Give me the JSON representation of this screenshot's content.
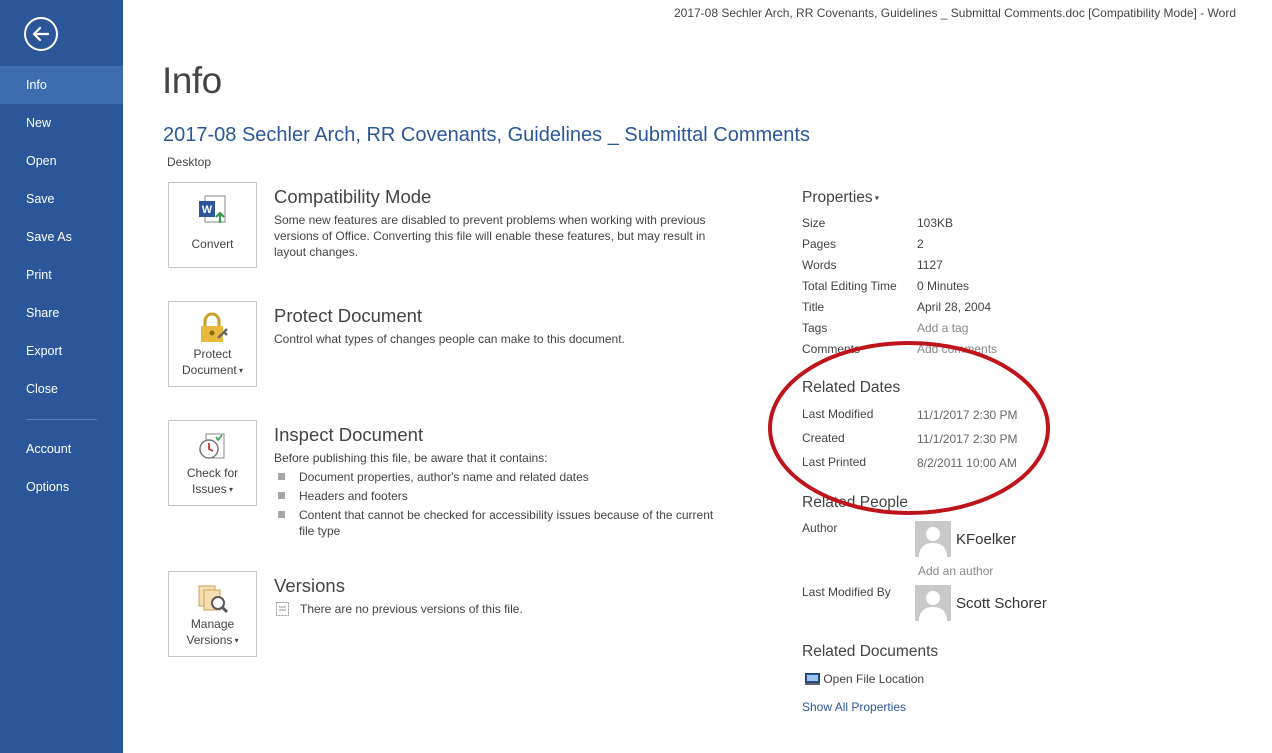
{
  "window": {
    "title": "2017-08 Sechler Arch, RR Covenants, Guidelines _ Submittal Comments.doc [Compatibility Mode] - Word"
  },
  "sidebar": {
    "items": [
      {
        "label": "Info"
      },
      {
        "label": "New"
      },
      {
        "label": "Open"
      },
      {
        "label": "Save"
      },
      {
        "label": "Save As"
      },
      {
        "label": "Print"
      },
      {
        "label": "Share"
      },
      {
        "label": "Export"
      },
      {
        "label": "Close"
      },
      {
        "label": "Account"
      },
      {
        "label": "Options"
      }
    ],
    "active": "Info"
  },
  "header": {
    "page_title": "Info",
    "doc_title": "2017-08 Sechler Arch, RR Covenants, Guidelines _ Submittal Comments",
    "location": "Desktop"
  },
  "sections": {
    "compat": {
      "button": "Convert",
      "title": "Compatibility Mode",
      "desc": "Some new features are disabled to prevent problems when working with previous versions of Office. Converting this file will enable these features, but may result in layout changes."
    },
    "protect": {
      "button_line1": "Protect",
      "button_line2": "Document",
      "title": "Protect Document",
      "desc": "Control what types of changes people can make to this document."
    },
    "inspect": {
      "button_line1": "Check for",
      "button_line2": "Issues",
      "title": "Inspect Document",
      "desc": "Before publishing this file, be aware that it contains:",
      "bullets": [
        "Document properties, author's name and related dates",
        "Headers and footers",
        "Content that cannot be checked for accessibility issues because of the current file type"
      ]
    },
    "versions": {
      "button_line1": "Manage",
      "button_line2": "Versions",
      "title": "Versions",
      "desc": "There are no previous versions of this file."
    }
  },
  "properties": {
    "heading": "Properties",
    "rows": [
      {
        "label": "Size",
        "value": "103KB"
      },
      {
        "label": "Pages",
        "value": "2"
      },
      {
        "label": "Words",
        "value": "1127"
      },
      {
        "label": "Total Editing Time",
        "value": "0 Minutes"
      },
      {
        "label": "Title",
        "value": "April 28, 2004"
      },
      {
        "label": "Tags",
        "value": "Add a tag"
      },
      {
        "label": "Comments",
        "value": "Add comments"
      }
    ]
  },
  "related_dates": {
    "heading": "Related Dates",
    "rows": [
      {
        "label": "Last Modified",
        "value": "11/1/2017 2:30 PM"
      },
      {
        "label": "Created",
        "value": "11/1/2017 2:30 PM"
      },
      {
        "label": "Last Printed",
        "value": "8/2/2011 10:00 AM"
      }
    ]
  },
  "related_people": {
    "heading": "Related People",
    "author_label": "Author",
    "author_name": "KFoelker",
    "add_author": "Add an author",
    "modified_by_label": "Last Modified By",
    "modified_by_name": "Scott Schorer"
  },
  "related_documents": {
    "heading": "Related Documents",
    "open_location": "Open File Location",
    "show_all": "Show All Properties"
  },
  "colors": {
    "sidebar": "#2b579a",
    "sidebar_active": "#3d6cb0",
    "accent_link": "#2b579a",
    "annotation": "#c0141c"
  }
}
